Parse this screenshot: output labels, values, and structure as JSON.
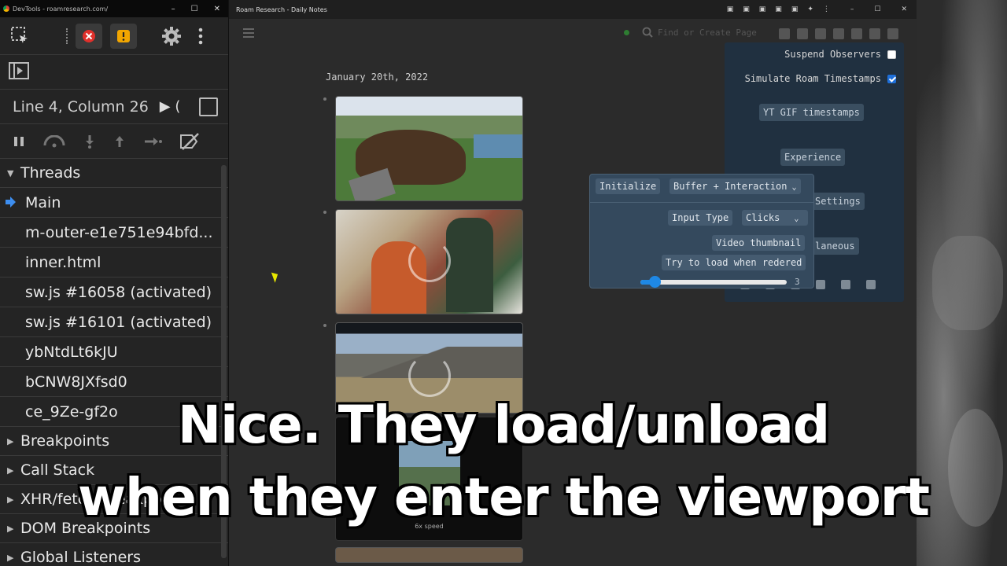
{
  "devtools": {
    "title": "DevTools - roamresearch.com/",
    "position": "Line 4, Column 26",
    "run_label": "▶ (",
    "threads_label": "Threads",
    "threads": [
      {
        "label": "Main",
        "active": true
      },
      {
        "label": "m-outer-e1e751e94bfd..."
      },
      {
        "label": "inner.html"
      },
      {
        "label": "sw.js #16058 (activated)"
      },
      {
        "label": "sw.js #16101 (activated)"
      },
      {
        "label": "ybNtdLt6kJU"
      },
      {
        "label": "bCNW8JXfsd0"
      },
      {
        "label": "ce_9Ze-gf2o"
      }
    ],
    "sections": [
      "Breakpoints",
      "Call Stack",
      "XHR/fetch Breakpoints",
      "DOM Breakpoints",
      "Global Listeners"
    ]
  },
  "roam": {
    "title": "Roam Research - Daily Notes",
    "search_placeholder": "Find or Create Page",
    "page_title": "January 20th, 2022",
    "video_speed": "6x speed"
  },
  "settings": {
    "suspend_observers": "Suspend Observers",
    "simulate_timestamps": "Simulate Roam Timestamps",
    "yt_gif_timestamps": "YT GIF timestamps",
    "experience": "Experience",
    "settings_tab": "Settings",
    "miscellaneous": "laneous"
  },
  "popover": {
    "initialize": "Initialize",
    "mode_select": "Buffer + Interaction",
    "input_type_label": "Input Type",
    "input_type_value": "Clicks",
    "video_thumbnail": "Video thumbnail",
    "try_load": "Try to load when redered",
    "slider_value": "3",
    "slider_fraction": 0.06
  },
  "caption": {
    "line1": "Nice. They load/unload",
    "line2": "when they enter the viewport"
  },
  "colors": {
    "accent": "#1e88e5",
    "panel": "#203040",
    "popover": "#34495d"
  }
}
